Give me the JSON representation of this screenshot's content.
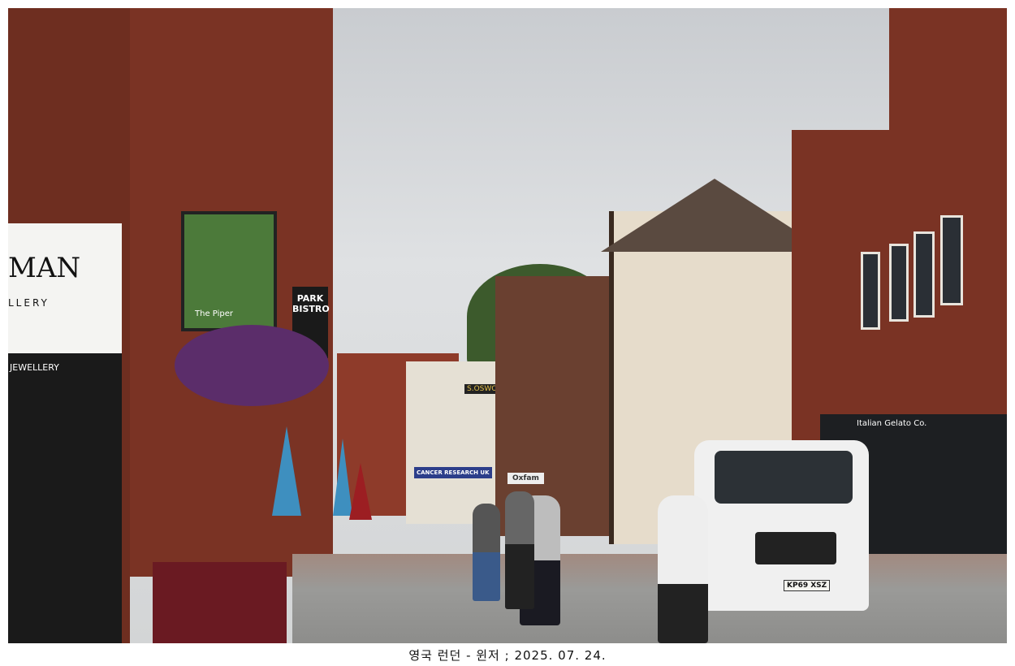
{
  "caption": "영국 런던 - 윈저 ; 2025. 07. 24.",
  "signs": {
    "gallery_top": "MAN",
    "gallery_sub": "LLERY",
    "jewellery": "JEWELLERY",
    "pub_name": "The Piper",
    "bistro": "PARK BISTRO",
    "gelato": "Italian Gelato Co.",
    "cancer": "CANCER RESEARCH UK",
    "oxfam": "Oxfam",
    "shop": "S.OSWOND",
    "plate": "KP69 XSZ"
  },
  "colors": {
    "sky": "#d6d8da",
    "brick": "#7a3324",
    "van": "#f2f2f2",
    "pavement": "#9a9a98"
  }
}
